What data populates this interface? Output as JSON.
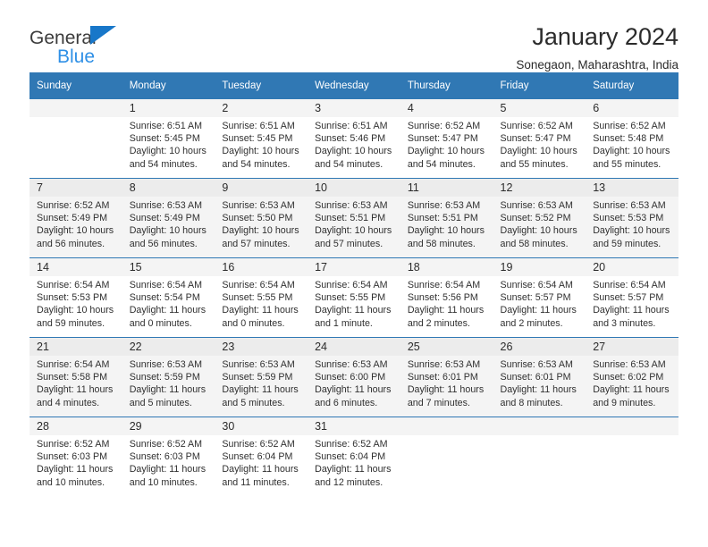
{
  "brand": {
    "line1": "General",
    "line2": "Blue",
    "triangle_color": "#1877c9",
    "line2_color": "#2f90e6"
  },
  "header": {
    "title": "January 2024",
    "subtitle": "Sonegaon, Maharashtra, India",
    "accent_color": "#3078b4"
  },
  "weekdays": [
    "Sunday",
    "Monday",
    "Tuesday",
    "Wednesday",
    "Thursday",
    "Friday",
    "Saturday"
  ],
  "labels": {
    "sunrise_prefix": "Sunrise:",
    "sunset_prefix": "Sunset:",
    "daylight_prefix": "Daylight:"
  },
  "weeks": [
    [
      {
        "day": "",
        "empty": true
      },
      {
        "day": "1",
        "sunrise": "Sunrise: 6:51 AM",
        "sunset": "Sunset: 5:45 PM",
        "daylight1": "Daylight: 10 hours",
        "daylight2": "and 54 minutes."
      },
      {
        "day": "2",
        "sunrise": "Sunrise: 6:51 AM",
        "sunset": "Sunset: 5:45 PM",
        "daylight1": "Daylight: 10 hours",
        "daylight2": "and 54 minutes."
      },
      {
        "day": "3",
        "sunrise": "Sunrise: 6:51 AM",
        "sunset": "Sunset: 5:46 PM",
        "daylight1": "Daylight: 10 hours",
        "daylight2": "and 54 minutes."
      },
      {
        "day": "4",
        "sunrise": "Sunrise: 6:52 AM",
        "sunset": "Sunset: 5:47 PM",
        "daylight1": "Daylight: 10 hours",
        "daylight2": "and 54 minutes."
      },
      {
        "day": "5",
        "sunrise": "Sunrise: 6:52 AM",
        "sunset": "Sunset: 5:47 PM",
        "daylight1": "Daylight: 10 hours",
        "daylight2": "and 55 minutes."
      },
      {
        "day": "6",
        "sunrise": "Sunrise: 6:52 AM",
        "sunset": "Sunset: 5:48 PM",
        "daylight1": "Daylight: 10 hours",
        "daylight2": "and 55 minutes."
      }
    ],
    [
      {
        "day": "7",
        "sunrise": "Sunrise: 6:52 AM",
        "sunset": "Sunset: 5:49 PM",
        "daylight1": "Daylight: 10 hours",
        "daylight2": "and 56 minutes."
      },
      {
        "day": "8",
        "sunrise": "Sunrise: 6:53 AM",
        "sunset": "Sunset: 5:49 PM",
        "daylight1": "Daylight: 10 hours",
        "daylight2": "and 56 minutes."
      },
      {
        "day": "9",
        "sunrise": "Sunrise: 6:53 AM",
        "sunset": "Sunset: 5:50 PM",
        "daylight1": "Daylight: 10 hours",
        "daylight2": "and 57 minutes."
      },
      {
        "day": "10",
        "sunrise": "Sunrise: 6:53 AM",
        "sunset": "Sunset: 5:51 PM",
        "daylight1": "Daylight: 10 hours",
        "daylight2": "and 57 minutes."
      },
      {
        "day": "11",
        "sunrise": "Sunrise: 6:53 AM",
        "sunset": "Sunset: 5:51 PM",
        "daylight1": "Daylight: 10 hours",
        "daylight2": "and 58 minutes."
      },
      {
        "day": "12",
        "sunrise": "Sunrise: 6:53 AM",
        "sunset": "Sunset: 5:52 PM",
        "daylight1": "Daylight: 10 hours",
        "daylight2": "and 58 minutes."
      },
      {
        "day": "13",
        "sunrise": "Sunrise: 6:53 AM",
        "sunset": "Sunset: 5:53 PM",
        "daylight1": "Daylight: 10 hours",
        "daylight2": "and 59 minutes."
      }
    ],
    [
      {
        "day": "14",
        "sunrise": "Sunrise: 6:54 AM",
        "sunset": "Sunset: 5:53 PM",
        "daylight1": "Daylight: 10 hours",
        "daylight2": "and 59 minutes."
      },
      {
        "day": "15",
        "sunrise": "Sunrise: 6:54 AM",
        "sunset": "Sunset: 5:54 PM",
        "daylight1": "Daylight: 11 hours",
        "daylight2": "and 0 minutes."
      },
      {
        "day": "16",
        "sunrise": "Sunrise: 6:54 AM",
        "sunset": "Sunset: 5:55 PM",
        "daylight1": "Daylight: 11 hours",
        "daylight2": "and 0 minutes."
      },
      {
        "day": "17",
        "sunrise": "Sunrise: 6:54 AM",
        "sunset": "Sunset: 5:55 PM",
        "daylight1": "Daylight: 11 hours",
        "daylight2": "and 1 minute."
      },
      {
        "day": "18",
        "sunrise": "Sunrise: 6:54 AM",
        "sunset": "Sunset: 5:56 PM",
        "daylight1": "Daylight: 11 hours",
        "daylight2": "and 2 minutes."
      },
      {
        "day": "19",
        "sunrise": "Sunrise: 6:54 AM",
        "sunset": "Sunset: 5:57 PM",
        "daylight1": "Daylight: 11 hours",
        "daylight2": "and 2 minutes."
      },
      {
        "day": "20",
        "sunrise": "Sunrise: 6:54 AM",
        "sunset": "Sunset: 5:57 PM",
        "daylight1": "Daylight: 11 hours",
        "daylight2": "and 3 minutes."
      }
    ],
    [
      {
        "day": "21",
        "sunrise": "Sunrise: 6:54 AM",
        "sunset": "Sunset: 5:58 PM",
        "daylight1": "Daylight: 11 hours",
        "daylight2": "and 4 minutes."
      },
      {
        "day": "22",
        "sunrise": "Sunrise: 6:53 AM",
        "sunset": "Sunset: 5:59 PM",
        "daylight1": "Daylight: 11 hours",
        "daylight2": "and 5 minutes."
      },
      {
        "day": "23",
        "sunrise": "Sunrise: 6:53 AM",
        "sunset": "Sunset: 5:59 PM",
        "daylight1": "Daylight: 11 hours",
        "daylight2": "and 5 minutes."
      },
      {
        "day": "24",
        "sunrise": "Sunrise: 6:53 AM",
        "sunset": "Sunset: 6:00 PM",
        "daylight1": "Daylight: 11 hours",
        "daylight2": "and 6 minutes."
      },
      {
        "day": "25",
        "sunrise": "Sunrise: 6:53 AM",
        "sunset": "Sunset: 6:01 PM",
        "daylight1": "Daylight: 11 hours",
        "daylight2": "and 7 minutes."
      },
      {
        "day": "26",
        "sunrise": "Sunrise: 6:53 AM",
        "sunset": "Sunset: 6:01 PM",
        "daylight1": "Daylight: 11 hours",
        "daylight2": "and 8 minutes."
      },
      {
        "day": "27",
        "sunrise": "Sunrise: 6:53 AM",
        "sunset": "Sunset: 6:02 PM",
        "daylight1": "Daylight: 11 hours",
        "daylight2": "and 9 minutes."
      }
    ],
    [
      {
        "day": "28",
        "sunrise": "Sunrise: 6:52 AM",
        "sunset": "Sunset: 6:03 PM",
        "daylight1": "Daylight: 11 hours",
        "daylight2": "and 10 minutes."
      },
      {
        "day": "29",
        "sunrise": "Sunrise: 6:52 AM",
        "sunset": "Sunset: 6:03 PM",
        "daylight1": "Daylight: 11 hours",
        "daylight2": "and 10 minutes."
      },
      {
        "day": "30",
        "sunrise": "Sunrise: 6:52 AM",
        "sunset": "Sunset: 6:04 PM",
        "daylight1": "Daylight: 11 hours",
        "daylight2": "and 11 minutes."
      },
      {
        "day": "31",
        "sunrise": "Sunrise: 6:52 AM",
        "sunset": "Sunset: 6:04 PM",
        "daylight1": "Daylight: 11 hours",
        "daylight2": "and 12 minutes."
      },
      {
        "day": "",
        "empty": true
      },
      {
        "day": "",
        "empty": true
      },
      {
        "day": "",
        "empty": true
      }
    ]
  ]
}
